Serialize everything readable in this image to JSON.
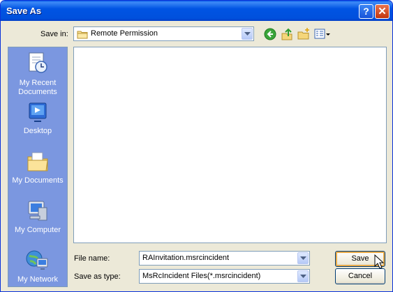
{
  "window": {
    "title": "Save As"
  },
  "titlebar": {
    "help_glyph": "?",
    "close_glyph": "✕"
  },
  "toolbar": {
    "save_in_label": "Save in:",
    "save_in_value": "Remote Permission",
    "icons": [
      "back-icon",
      "up-folder-icon",
      "new-folder-icon",
      "views-menu-icon"
    ]
  },
  "places": [
    {
      "id": "recent",
      "label_line1": "My Recent",
      "label_line2": "Documents",
      "icon": "recent-documents-icon"
    },
    {
      "id": "desktop",
      "label_line1": "Desktop",
      "label_line2": "",
      "icon": "desktop-icon"
    },
    {
      "id": "documents",
      "label_line1": "My Documents",
      "label_line2": "",
      "icon": "my-documents-icon"
    },
    {
      "id": "computer",
      "label_line1": "My Computer",
      "label_line2": "",
      "icon": "my-computer-icon"
    },
    {
      "id": "network",
      "label_line1": "My Network",
      "label_line2": "",
      "icon": "my-network-icon"
    }
  ],
  "form": {
    "file_name_label": "File name:",
    "file_name_value": "RAInvitation.msrcincident",
    "save_type_label": "Save as type:",
    "save_type_value": "MsRcIncident Files(*.msrcincident)"
  },
  "buttons": {
    "save": "Save",
    "cancel": "Cancel"
  },
  "colors": {
    "title_bar": "#0054e3",
    "places_bar": "#7b97e0",
    "dialog_bg": "#ece9d8"
  }
}
